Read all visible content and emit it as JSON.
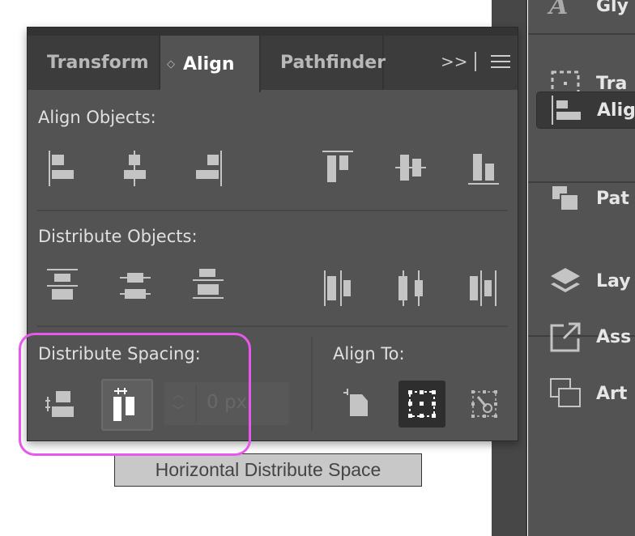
{
  "panel": {
    "tabs": [
      {
        "label": "Transform",
        "active": false
      },
      {
        "label": "Align",
        "active": true
      },
      {
        "label": "Pathfinder",
        "active": false
      }
    ],
    "overflow_label": ">>",
    "menu_icon": "hamburger-icon",
    "align_objects_label": "Align Objects:",
    "align_objects_buttons": [
      "horizontal-align-left",
      "horizontal-align-center",
      "horizontal-align-right",
      "vertical-align-top",
      "vertical-align-center",
      "vertical-align-bottom"
    ],
    "distribute_objects_label": "Distribute Objects:",
    "distribute_objects_buttons": [
      "vertical-distribute-top",
      "vertical-distribute-center",
      "vertical-distribute-bottom",
      "horizontal-distribute-left",
      "horizontal-distribute-center",
      "horizontal-distribute-right"
    ],
    "distribute_spacing_label": "Distribute Spacing:",
    "spacing_value": "0 px",
    "align_to_label": "Align To:",
    "align_to_selected": "align-to-selection"
  },
  "tooltip": "Horizontal Distribute Space",
  "dock": {
    "items": [
      {
        "label": "Gly"
      },
      {
        "label": "Tra"
      },
      {
        "label": "Alig",
        "active": true
      },
      {
        "label": "Pat"
      },
      {
        "label": "Lay"
      },
      {
        "label": "Ass"
      },
      {
        "label": "Art"
      }
    ]
  },
  "colors": {
    "highlight": "#e659ec",
    "panel": "#535353",
    "tabbar": "#3c3c3c"
  }
}
